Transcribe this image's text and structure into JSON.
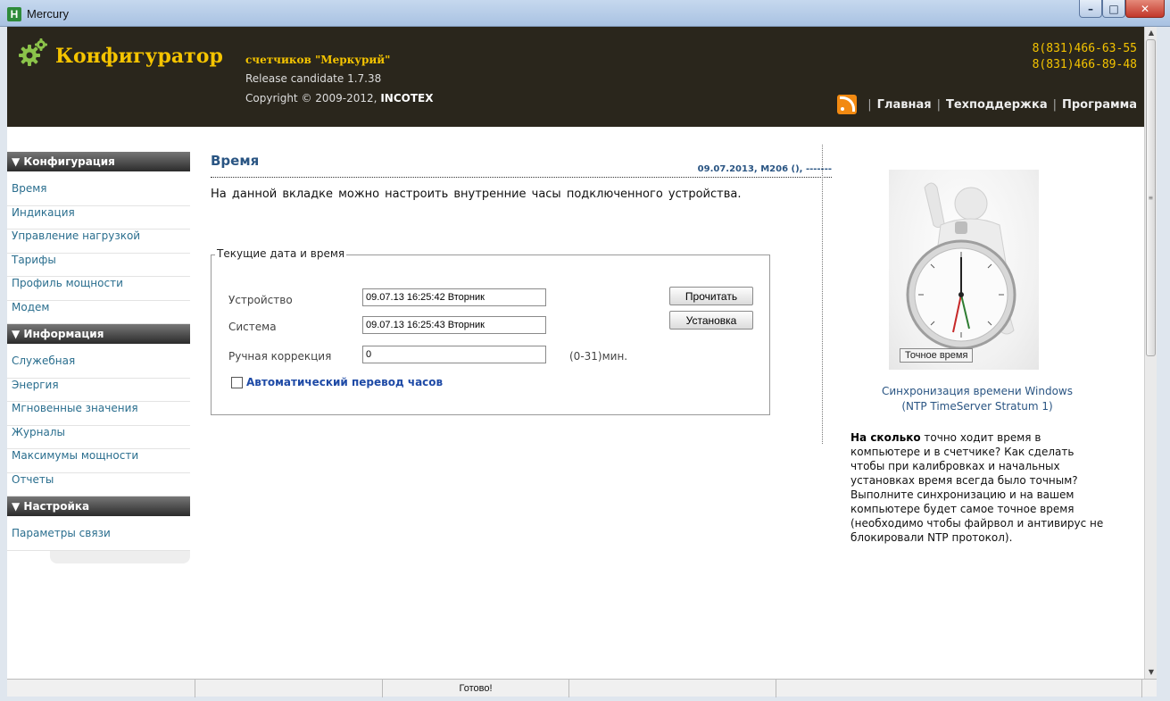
{
  "window": {
    "title": "Mercury",
    "minimize": "–",
    "maximize": "□",
    "close": "✕"
  },
  "header": {
    "brand": "Конфигуратор",
    "subbrand": "счетчиков \"Меркурий\"",
    "release": "Release candidate 1.7.38",
    "copyright": "Copyright © 2009-2012,",
    "company": "INCOTEX",
    "phones": [
      "8(831)466-63-55",
      "8(831)466-89-48"
    ],
    "nav": [
      "Главная",
      "Техподдержка",
      "Программа"
    ],
    "nav_sep": "|"
  },
  "sidebar": {
    "sections": [
      {
        "title": "▼ Конфигурация",
        "items": [
          "Время",
          "Индикация",
          "Управление нагрузкой",
          "Тарифы",
          "Профиль мощности",
          "Модем"
        ]
      },
      {
        "title": "▼ Информация",
        "items": [
          "Служебная",
          "Энергия",
          "Мгновенные значения",
          "Журналы",
          "Максимумы мощности",
          "Отчеты"
        ]
      },
      {
        "title": "▼ Настройка",
        "items": [
          "Параметры связи"
        ]
      }
    ]
  },
  "main": {
    "title": "Время",
    "meta": "09.07.2013, M206 (), -------",
    "intro": "На данной вкладке можно настроить внутренние часы подключенного устройства.",
    "fieldset": {
      "legend": "Текущие дата и время",
      "device_label": "Устройство",
      "device_value": "09.07.13  16:25:42  Вторник",
      "system_label": "Система",
      "system_value": "09.07.13  16:25:43  Вторник",
      "manual_label": "Ручная коррекция",
      "manual_value": "0",
      "manual_hint": "(0-31)мин.",
      "read_button": "Прочитать",
      "set_button": "Установка",
      "auto_dst_label": "Автоматический перевод часов",
      "auto_dst_checked": false
    }
  },
  "promo": {
    "image_caption": "Точное время",
    "title_line1": "Синхронизация времени Windows",
    "title_line2": "(NTP TimeServer Stratum 1)",
    "text_bold": "На сколько",
    "text": " точно ходит время в компьютере и в счетчике? Как сделать чтобы при калибровках и начальных установках время всегда было точным? Выполните синхронизацию и на вашем компьютере будет самое точное время (необходимо чтобы файрвол и антивирус не блокировали NTP протокол)."
  },
  "status": {
    "text": "Готово!"
  },
  "colors": {
    "header_bg": "#2a261c",
    "brand": "#f5c400",
    "link": "#2a6e8e",
    "title": "#2a5583",
    "rss": "#f28a12"
  }
}
